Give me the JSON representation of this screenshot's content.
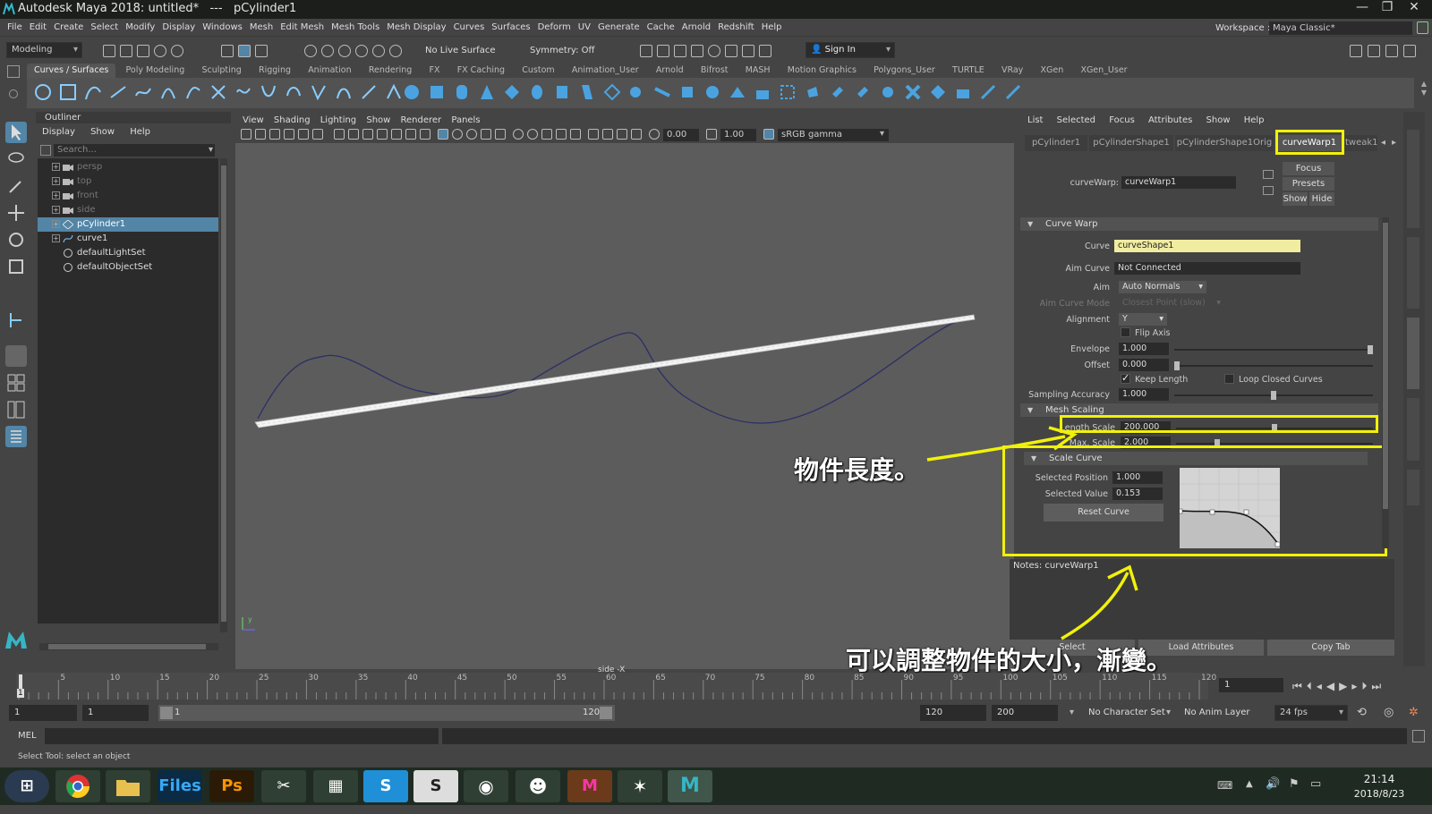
{
  "window": {
    "title": "Autodesk Maya 2018: untitled*   ---   pCylinder1",
    "minimize": "—",
    "maximize": "❐",
    "close": "✕"
  },
  "menubar": {
    "items": [
      "File",
      "Edit",
      "Create",
      "Select",
      "Modify",
      "Display",
      "Windows",
      "Mesh",
      "Edit Mesh",
      "Mesh Tools",
      "Mesh Display",
      "Curves",
      "Surfaces",
      "Deform",
      "UV",
      "Generate",
      "Cache",
      "Arnold",
      "Redshift",
      "Help"
    ],
    "workspace_label": "Workspace :",
    "workspace_value": "Maya Classic*"
  },
  "statusline": {
    "menuset": "Modeling",
    "live_surface": "No Live Surface",
    "symmetry": "Symmetry: Off",
    "sign_in": "Sign In"
  },
  "shelf": {
    "tabs": [
      "Curves / Surfaces",
      "Poly Modeling",
      "Sculpting",
      "Rigging",
      "Animation",
      "Rendering",
      "FX",
      "FX Caching",
      "Custom",
      "Animation_User",
      "Arnold",
      "Bifrost",
      "MASH",
      "Motion Graphics",
      "Polygons_User",
      "TURTLE",
      "VRay",
      "XGen",
      "XGen_User"
    ],
    "active_tab": "Curves / Surfaces"
  },
  "outliner": {
    "title": "Outliner",
    "menus": [
      "Display",
      "Show",
      "Help"
    ],
    "search_placeholder": "Search...",
    "items": [
      {
        "label": "persp",
        "dim": true
      },
      {
        "label": "top",
        "dim": true
      },
      {
        "label": "front",
        "dim": true
      },
      {
        "label": "side",
        "dim": true
      },
      {
        "label": "pCylinder1",
        "selected": true
      },
      {
        "label": "curve1"
      },
      {
        "label": "defaultLightSet"
      },
      {
        "label": "defaultObjectSet"
      }
    ]
  },
  "viewport": {
    "menus": [
      "View",
      "Shading",
      "Lighting",
      "Show",
      "Renderer",
      "Panels"
    ],
    "exposure": "0.00",
    "gamma": "1.00",
    "color_space": "sRGB gamma",
    "camera_label": "side -X",
    "axis_y": "y"
  },
  "attribute_editor": {
    "menus": [
      "List",
      "Selected",
      "Focus",
      "Attributes",
      "Show",
      "Help"
    ],
    "tabs": [
      "pCylinder1",
      "pCylinderShape1",
      "pCylinderShape1Orig",
      "curveWarp1",
      "tweak1"
    ],
    "active_tab": "curveWarp1",
    "node_label": "curveWarp:",
    "node_value": "curveWarp1",
    "buttons": {
      "focus": "Focus",
      "presets": "Presets",
      "show": "Show",
      "hide": "Hide"
    },
    "curve_warp": {
      "section": "Curve Warp",
      "curve_label": "Curve",
      "curve_value": "curveShape1",
      "aim_curve_label": "Aim Curve",
      "aim_curve_value": "Not Connected",
      "aim_label": "Aim",
      "aim_value": "Auto Normals",
      "aim_curve_mode_label": "Aim Curve Mode",
      "aim_curve_mode_value": "Closest Point (slow)",
      "alignment_label": "Alignment",
      "alignment_value": "Y",
      "flip_axis_label": "Flip Axis",
      "envelope_label": "Envelope",
      "envelope_value": "1.000",
      "envelope_level": 1.0,
      "offset_label": "Offset",
      "offset_value": "0.000",
      "offset_level": 0.0,
      "keep_length_label": "Keep Length",
      "loop_closed_label": "Loop Closed Curves",
      "sampling_label": "Sampling Accuracy",
      "sampling_value": "1.000",
      "sampling_level": 0.5
    },
    "mesh_scaling": {
      "section": "Mesh Scaling",
      "length_scale_label": "Length Scale",
      "length_scale_value": "200.000",
      "length_scale_level": 0.5,
      "max_scale_label": "Max. Scale",
      "max_scale_value": "2.000",
      "max_scale_level": 0.2
    },
    "scale_curve": {
      "section": "Scale Curve",
      "selected_position_label": "Selected Position",
      "selected_position_value": "1.000",
      "selected_value_label": "Selected Value",
      "selected_value_value": "0.153",
      "reset_button": "Reset Curve"
    },
    "notes_label": "Notes:  curveWarp1",
    "bottom_buttons": [
      "Select",
      "Load Attributes",
      "Copy Tab"
    ]
  },
  "annotations": {
    "length_note": "物件長度。",
    "scale_note": "可以調整物件的大小，漸變。",
    "color": "#f1f10a"
  },
  "timeline": {
    "ticks": [
      "5",
      "10",
      "15",
      "20",
      "25",
      "30",
      "35",
      "40",
      "45",
      "50",
      "55",
      "60",
      "65",
      "70",
      "75",
      "80",
      "85",
      "90",
      "95",
      "100",
      "105",
      "110",
      "115",
      "120"
    ],
    "current_frame": "1",
    "current_frame_field": "1"
  },
  "range": {
    "start": "1",
    "playback_start": "1",
    "slider_start": "1",
    "slider_end": "120",
    "playback_end": "120",
    "end": "200",
    "character_set": "No Character Set",
    "anim_layer": "No Anim Layer",
    "fps": "24 fps"
  },
  "command_line": {
    "label": "MEL"
  },
  "help_line": "Select Tool: select an object",
  "taskbar": {
    "apps": [
      "⊞",
      "Chrome",
      "Files",
      "Ps",
      "Ai",
      "Clip",
      "Calc",
      "S",
      "S",
      "Steam",
      "Bot",
      "M",
      "Zbrush",
      "Maya"
    ],
    "time": "21:14",
    "date": "2018/8/23"
  }
}
